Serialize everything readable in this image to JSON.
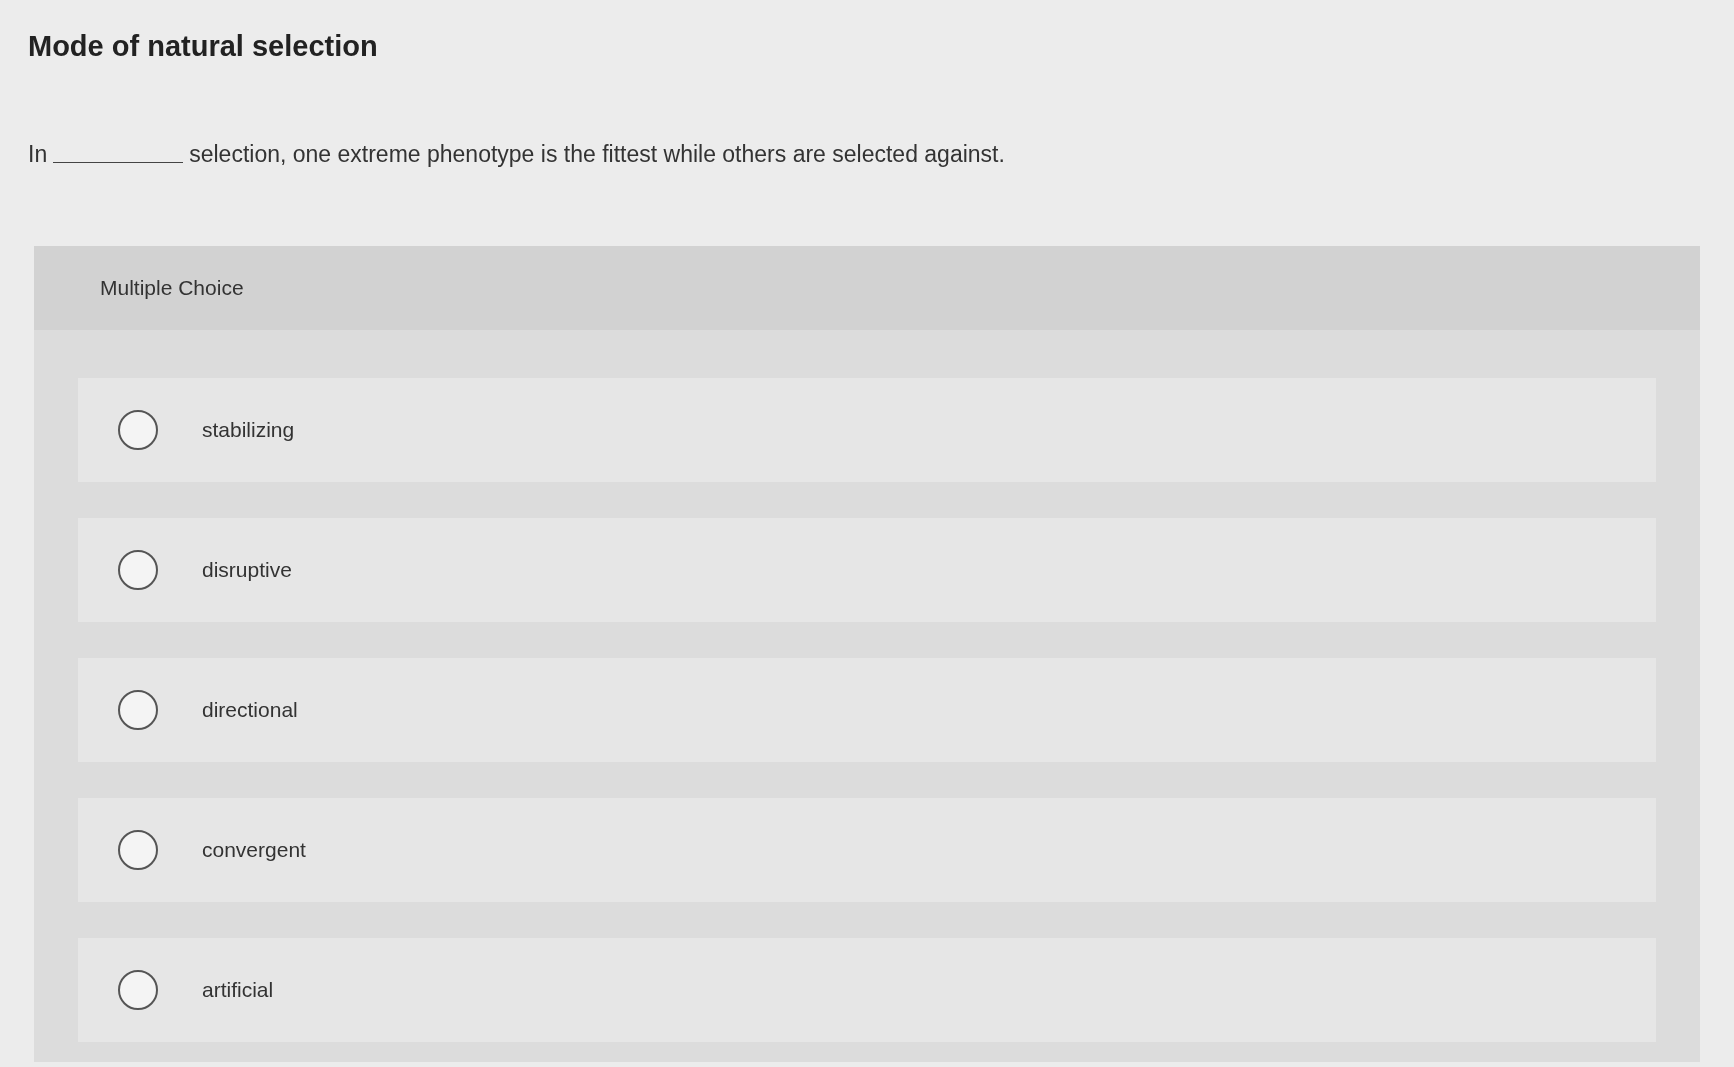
{
  "title": "Mode of natural selection",
  "question": {
    "before": "In",
    "after": "selection, one extreme phenotype is the fittest while others are selected against."
  },
  "panel": {
    "heading": "Multiple Choice"
  },
  "options": [
    {
      "label": "stabilizing",
      "selected": false
    },
    {
      "label": "disruptive",
      "selected": false
    },
    {
      "label": "directional",
      "selected": false
    },
    {
      "label": "convergent",
      "selected": false
    },
    {
      "label": "artificial",
      "selected": false
    }
  ]
}
